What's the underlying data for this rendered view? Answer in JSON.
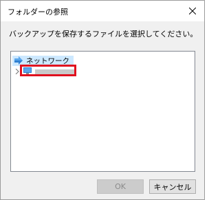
{
  "window": {
    "title": "フォルダーの参照",
    "close_icon": "close-icon"
  },
  "instruction": "バックアップを保存するファイルを選択してください。",
  "tree": {
    "root": {
      "label": "ネットワーク",
      "icon": "network-icon",
      "selected": true
    },
    "child": {
      "label": "",
      "icon": "computer-icon",
      "label_redacted": true,
      "expand_icon": "chevron-right-icon"
    }
  },
  "buttons": {
    "ok_label": "OK",
    "ok_enabled": false,
    "cancel_label": "キャンセル"
  },
  "colors": {
    "highlight_box": "#e0101e",
    "selection": "#cce8ff",
    "dialog_bg": "#f0f0f0"
  }
}
